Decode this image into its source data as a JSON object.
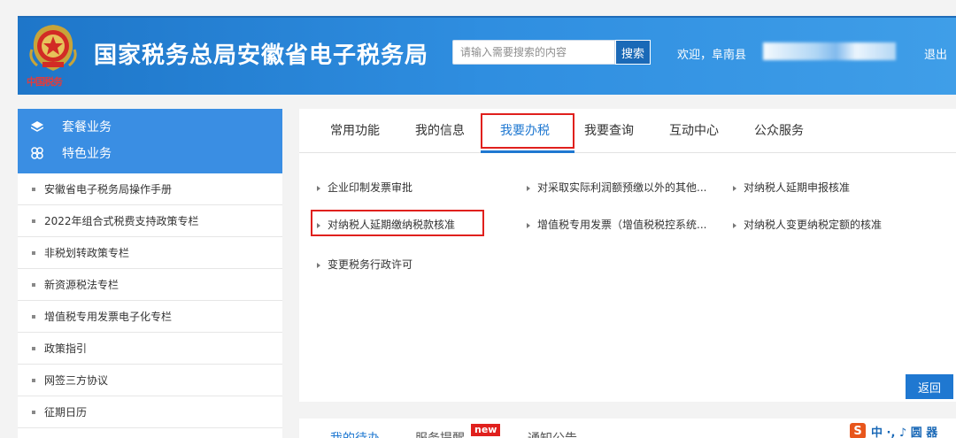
{
  "header": {
    "title": "国家税务总局安徽省电子税务局",
    "search_placeholder": "请输入需要搜索的内容",
    "search_button": "搜索",
    "welcome": "欢迎，阜南县",
    "logout": "退出",
    "emblem_subtext": "中国税务"
  },
  "sidebar": {
    "head_items": [
      {
        "label": "套餐业务",
        "icon": "layers-icon"
      },
      {
        "label": "特色业务",
        "icon": "clover-icon"
      }
    ],
    "items": [
      "安徽省电子税务局操作手册",
      "2022年组合式税费支持政策专栏",
      "非税划转政策专栏",
      "新资源税法专栏",
      "增值税专用发票电子化专栏",
      "政策指引",
      "网签三方协议",
      "征期日历"
    ]
  },
  "main": {
    "tabs": [
      "常用功能",
      "我的信息",
      "我要办税",
      "我要查询",
      "互动中心",
      "公众服务"
    ],
    "active_tab": "我要办税",
    "functions": [
      "企业印制发票审批",
      "对采取实际利润额预缴以外的其他...",
      "对纳税人延期申报核准",
      "对纳税人延期缴纳税款核准",
      "增值税专用发票（增值税税控系统...",
      "对纳税人变更纳税定额的核准",
      "变更税务行政许可"
    ],
    "back_button": "返回"
  },
  "bottom": {
    "tabs": [
      "我的待办",
      "服务提醒",
      "通知公告"
    ],
    "new_badge": "new",
    "ime_label": "S",
    "ime_text": "中 ·, ♪ 圆 器"
  },
  "colors": {
    "header_blue": "#2f8ee0",
    "accent_blue": "#1f78d1",
    "sidebar_head": "#3a8ee3",
    "highlight_red": "#e0201d"
  }
}
